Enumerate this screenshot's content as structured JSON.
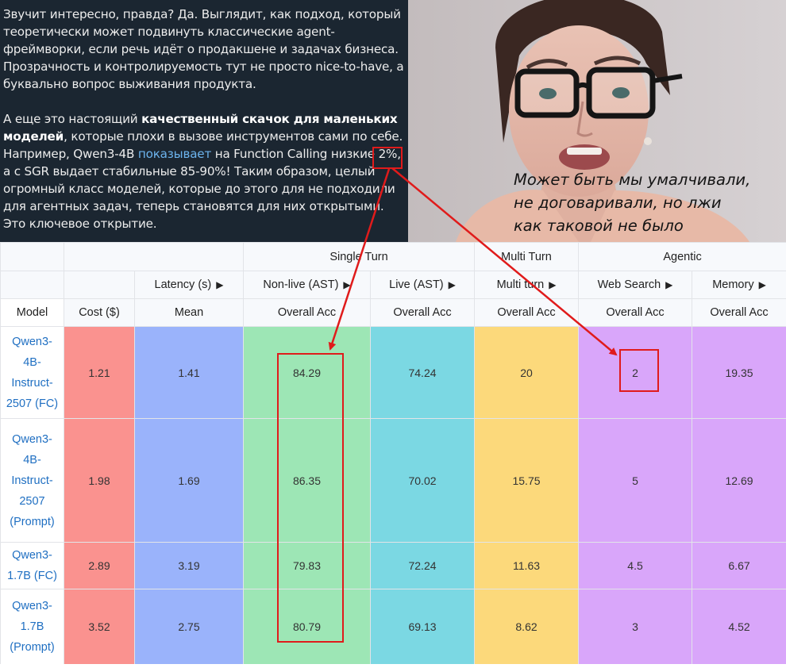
{
  "text_panel": {
    "paragraph1": "Звучит интересно, правда? Да. Выглядит, как подход, который теоретически может подвинуть классические agent-фреймворки, если речь идёт о продакшене и задачах бизнеса. Прозрачность и контролируемость тут не просто nice-to-have, а буквально вопрос выживания продукта.",
    "p2_a": "А еще это настоящий ",
    "p2_bold": "качественный скачок для маленьких моделей",
    "p2_b": ", которые плохи в вызове инструментов сами по себе. Например, Qwen3-4B ",
    "p2_link": "показывает",
    "p2_c": " на Function Calling низкие ",
    "p2_pct": "2%",
    "p2_d": ", а с SGR выдает стабильные 85-90%! Таким образом, целый огромный класс моделей, которые до этого для не подходили для агентных задач, теперь становятся для них открытыми. Это ключевое открытие."
  },
  "photo": {
    "caption_lines": [
      "Может быть мы умалчивали,",
      "не договаривали, но лжи",
      "как таковой не было"
    ]
  },
  "table": {
    "groups": {
      "single_turn": "Single Turn",
      "multi_turn": "Multi Turn",
      "agentic": "Agentic"
    },
    "subgroups": {
      "latency": "Latency (s)",
      "non_live": "Non-live (AST)",
      "live": "Live (AST)",
      "multi_turn": "Multi turn",
      "web_search": "Web Search",
      "memory": "Memory"
    },
    "arrow_glyph": "▶",
    "columns": {
      "model": "Model",
      "cost": "Cost ($)",
      "mean": "Mean",
      "non_live_acc": "Overall Acc",
      "live_acc": "Overall Acc",
      "multi_acc": "Overall Acc",
      "web_acc": "Overall Acc",
      "mem_acc": "Overall Acc"
    },
    "rows": [
      {
        "model": "Qwen3-4B-Instruct-2507 (FC)",
        "model_lines": [
          "Qwen3-",
          "4B-",
          "Instruct-",
          "2507 (FC)"
        ],
        "cost": "1.21",
        "latency": "1.41",
        "non_live": "84.29",
        "live": "74.24",
        "multi_turn": "20",
        "web_search": "2",
        "memory": "19.35"
      },
      {
        "model": "Qwen3-4B-Instruct-2507 (Prompt)",
        "model_lines": [
          "Qwen3-",
          "4B-",
          "Instruct-",
          "2507",
          "(Prompt)"
        ],
        "cost": "1.98",
        "latency": "1.69",
        "non_live": "86.35",
        "live": "70.02",
        "multi_turn": "15.75",
        "web_search": "5",
        "memory": "12.69"
      },
      {
        "model": "Qwen3-1.7B (FC)",
        "model_lines": [
          "Qwen3-",
          "1.7B (FC)"
        ],
        "cost": "2.89",
        "latency": "3.19",
        "non_live": "79.83",
        "live": "72.24",
        "multi_turn": "11.63",
        "web_search": "4.5",
        "memory": "6.67"
      },
      {
        "model": "Qwen3-1.7B (Prompt)",
        "model_lines": [
          "Qwen3-",
          "1.7B",
          "(Prompt)"
        ],
        "cost": "3.52",
        "latency": "2.75",
        "non_live": "80.79",
        "live": "69.13",
        "multi_turn": "8.62",
        "web_search": "3",
        "memory": "4.52"
      }
    ]
  },
  "colors": {
    "panel_bg": "#1b2631",
    "link": "#6cb4ee",
    "annotation": "#e01b1b",
    "cost": "#fa928f",
    "latency": "#9ab3fb",
    "non_live": "#9de6b5",
    "live": "#7bd8e3",
    "multi_turn": "#fcd97b",
    "agentic": "#d9a6fa",
    "model_link": "#1f6fc2"
  }
}
